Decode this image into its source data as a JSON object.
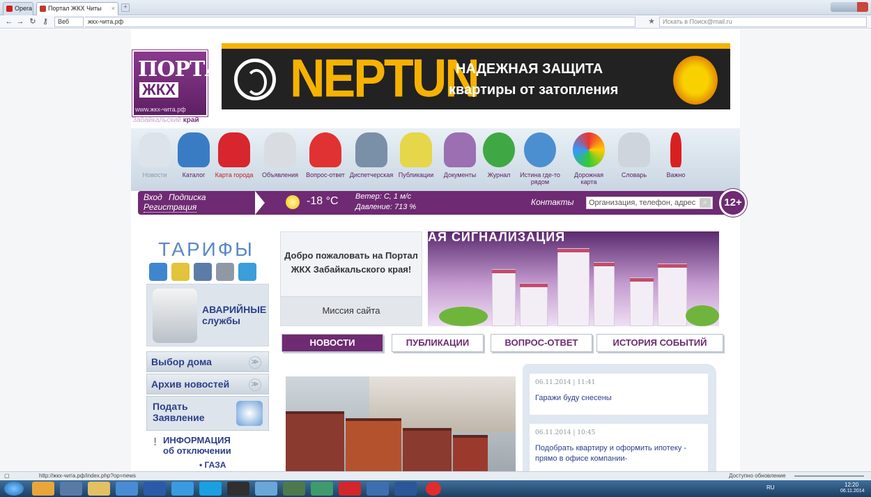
{
  "browser": {
    "app_label": "Opera",
    "tab_title": "Портал ЖКХ Читы",
    "address": "жкх-чита.рф",
    "security_label": "Веб",
    "search_placeholder": "Искать в Поиск@mail.ru",
    "status_url": "http://жкх-чита.рф/index.php?op=news",
    "status_right": "Доступно обновление",
    "tray_lang": "RU",
    "tray_time": "12:20",
    "tray_date": "06.11.2014"
  },
  "header": {
    "logo_top": "ПОРТАЛ",
    "logo_mid": "ЖКХ",
    "logo_url": "www.жкх-чита.рф",
    "region_a": "Забайкальский",
    "region_b": "край",
    "banner_brand": "NEPTUN",
    "banner_line1": "НАДЕЖНАЯ ЗАЩИТА",
    "banner_line2": "квартиры от затопления"
  },
  "nav": [
    {
      "label": "Новости"
    },
    {
      "label": "Каталог"
    },
    {
      "label": "Карта города"
    },
    {
      "label": "Объявления"
    },
    {
      "label": "Вопрос-ответ"
    },
    {
      "label": "Диспетчерская"
    },
    {
      "label": "Публикации"
    },
    {
      "label": "Документы"
    },
    {
      "label": "Журнал"
    },
    {
      "label": "Истина где-то рядом"
    },
    {
      "label": "Дорожная карта"
    },
    {
      "label": "Словарь"
    },
    {
      "label": "Важно"
    }
  ],
  "bar": {
    "login": "Вход",
    "subscribe": "Подписка",
    "register": "Регистрация",
    "temperature": "-18 °С",
    "wind": "Ветер: С, 1 м/с",
    "pressure": "Давление: 713 %",
    "contacts": "Контакты",
    "search_placeholder": "Организация, телефон, адрес",
    "age": "12+"
  },
  "left": {
    "tariffs": "ТАРИФЫ",
    "emergency_1": "АВАРИЙНЫЕ",
    "emergency_2": "службы",
    "select_house": "Выбор дома",
    "news_archive": "Архив новостей",
    "apply_1": "Подать",
    "apply_2": "Заявление",
    "info_1": "ИНФОРМАЦИЯ",
    "info_2": "об отключении",
    "info_gas": "• ГАЗА"
  },
  "center": {
    "welcome": "Добро пожаловать на Портал ЖКХ Забайкальского края!",
    "mission": "Миссия сайта",
    "promo_text": "АЯ СИГНАЛИЗАЦИЯ"
  },
  "tabs": [
    {
      "label": "НОВОСТИ"
    },
    {
      "label": "ПУБЛИКАЦИИ"
    },
    {
      "label": "ВОПРОС-ОТВЕТ"
    },
    {
      "label": "ИСТОРИЯ СОБЫТИЙ"
    }
  ],
  "news": [
    {
      "date": "06.11.2014 | 11:41",
      "title": "Гаражи буду снесены"
    },
    {
      "date": "06.11.2014 | 10:45",
      "title": "Подобрать квартиру и оформить ипотеку - прямо в офисе компании-"
    }
  ],
  "colors": {
    "brand": "#6e2a72",
    "accent": "#f6b200",
    "link": "#2b3f8a"
  }
}
